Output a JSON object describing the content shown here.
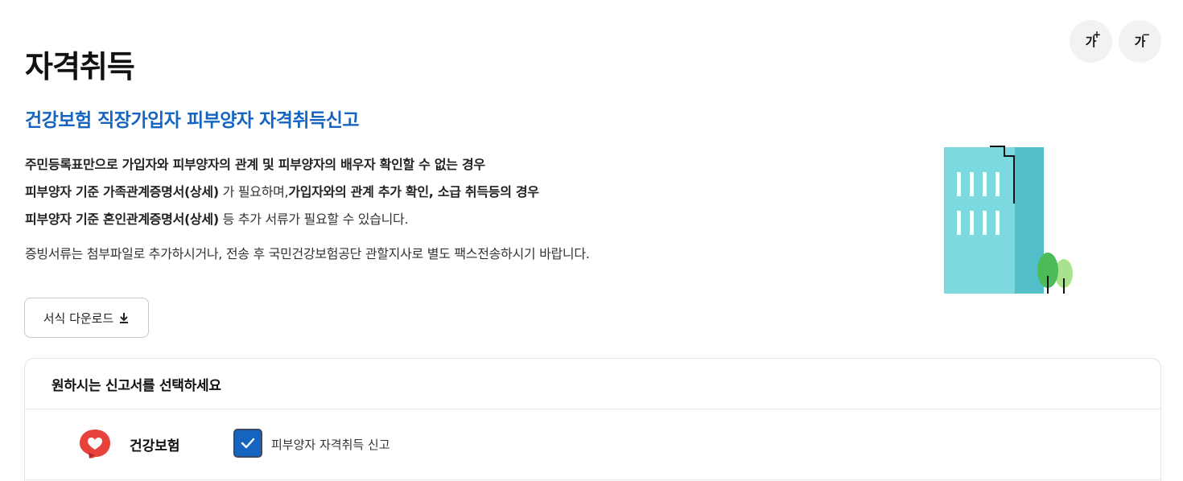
{
  "font_controls": {
    "increase_label": "가",
    "increase_mark": "+",
    "decrease_label": "가",
    "decrease_mark": "−"
  },
  "page_title": "자격취득",
  "sub_title": "건강보험 직장가입자 피부양자 자격취득신고",
  "description": {
    "line1_bold": "주민등록표만으로 가입자와 피부양자의 관계 및 피부양자의 배우자 확인할 수 없는 경우",
    "line2_bold": "피부양자 기준 가족관계증명서(상세)",
    "line2_normal": " 가 필요하며,",
    "line2_bold2": "가입자와의 관계 추가 확인, 소급 취득등의 경우",
    "line3_bold": "피부양자 기준 혼인관계증명서(상세)",
    "line3_normal": " 등 추가 서류가 필요할 수 있습니다.",
    "note": "증빙서류는 첨부파일로 추가하시거나, 전송 후 국민건강보험공단 관할지사로 별도 팩스전송하시기 바랍니다."
  },
  "download_button": {
    "label": "서식 다운로드",
    "icon": "download-icon"
  },
  "panel": {
    "header": "원하시는 신고서를 선택하세요",
    "rows": [
      {
        "label": "건강보험",
        "logo_icon": "health-insurance-logo-icon",
        "checkbox_checked": true,
        "option_label": "피부양자 자격취득 신고"
      }
    ]
  },
  "colors": {
    "accent": "#1565c0",
    "building_light": "#7dd9e0",
    "building_dark": "#52bfc9",
    "tree_dark": "#4cbb58",
    "tree_light": "#a8e28d",
    "logo_red": "#e8423c"
  }
}
